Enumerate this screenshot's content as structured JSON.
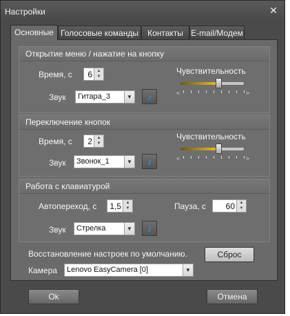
{
  "window": {
    "title": "Настройки"
  },
  "tabs": [
    "Основные",
    "Голосовые команды",
    "Контакты",
    "E-mail/Модем"
  ],
  "groups": {
    "menu": {
      "title": "Открытие меню / нажатие на кнопку",
      "time_label": "Время, с",
      "time_value": "6",
      "sound_label": "Звук",
      "sound_value": "Гитара_3",
      "sensitivity_label": "Чувствительность",
      "sensitivity_level": 0.6
    },
    "switch": {
      "title": "Переключение кнопок",
      "time_label": "Время, с",
      "time_value": "2",
      "sound_label": "Звук",
      "sound_value": "Звонок_1",
      "sensitivity_label": "Чувствительность",
      "sensitivity_level": 0.6
    },
    "keyboard": {
      "title": "Работа с клавиатурой",
      "autoswitch_label": "Автопереход, с",
      "autoswitch_value": "1,5",
      "pause_label": "Пауза, с",
      "pause_value": "60",
      "sound_label": "Звук",
      "sound_value": "Стрелка"
    }
  },
  "restore": {
    "text": "Восстановление настроек по умолчанию.",
    "button": "Сброс"
  },
  "camera": {
    "label": "Камера",
    "value": "Lenovo EasyCamera [0]"
  },
  "footer": {
    "ok": "Ok",
    "cancel": "Отмена"
  },
  "icons": {
    "close": "close-icon",
    "note": "music-note-icon"
  },
  "colors": {
    "slider_fill": "#f0c020",
    "note_icon": "#3b8ee6"
  }
}
